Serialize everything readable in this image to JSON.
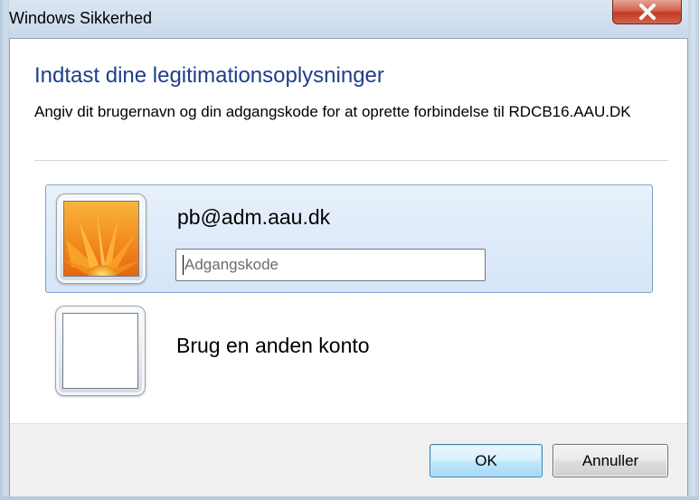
{
  "window": {
    "title": "Windows Sikkerhed",
    "close_icon": "close-x-icon",
    "accent_color": "#c23b22"
  },
  "dialog": {
    "heading": "Indtast dine legitimationsoplysninger",
    "description": "Angiv dit brugernavn og din adgangskode for at oprette forbindelse til RDCB16.AAU.DK",
    "heading_color": "#1e3f8a"
  },
  "accounts": [
    {
      "username": "pb@adm.aau.dk",
      "avatar_icon": "flower-avatar-icon",
      "selected": true,
      "password_value": "",
      "password_placeholder": "Adgangskode"
    },
    {
      "label": "Brug en anden konto",
      "avatar_icon": "blank-avatar-icon",
      "selected": false
    }
  ],
  "footer": {
    "ok_label": "OK",
    "cancel_label": "Annuller"
  }
}
